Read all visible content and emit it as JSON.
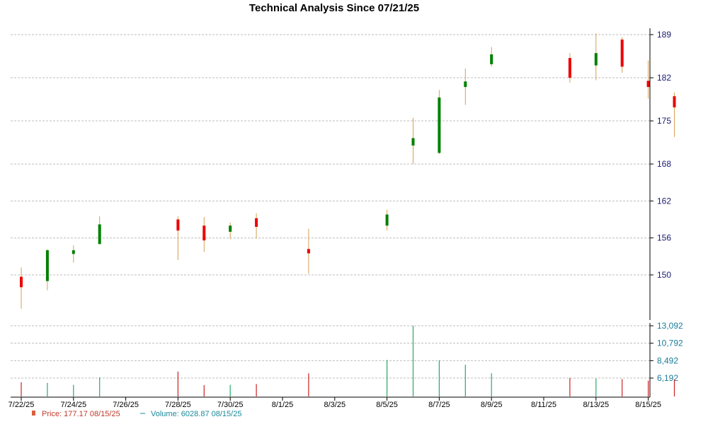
{
  "title": "Technical Analysis Since 07/21/25",
  "legend": {
    "price": "Price: 177.17  08/15/25",
    "volume": "Volume: 6028.87  08/15/25"
  },
  "colors": {
    "up": "#008000",
    "down": "#ee0000",
    "wick": "#d4a055",
    "grid": "#bdbdbd",
    "volume_up": "#2aa86a",
    "volume_down": "#cc2222",
    "price_axis": "#1a1a6e",
    "volume_axis": "#1a7a9a",
    "legend_price": "#c0392b",
    "legend_volume": "#1a8a9a"
  },
  "chart_data": [
    {
      "type": "candlestick",
      "title": "Technical Analysis Since 07/21/25",
      "ylim": [
        143.5,
        190.5
      ],
      "yticks": [
        150,
        156,
        162,
        168,
        175,
        182,
        189
      ],
      "grid": true,
      "x_tick_labels": [
        "7/22/25",
        "7/24/25",
        "7/26/25",
        "7/28/25",
        "7/30/25",
        "8/1/25",
        "8/3/25",
        "8/5/25",
        "8/7/25",
        "8/9/25",
        "8/11/25",
        "8/13/25",
        "8/15/25"
      ],
      "candles": [
        {
          "date": "7/22/25",
          "open": 149.7,
          "high": 151.2,
          "low": 144.5,
          "close": 148.0
        },
        {
          "date": "7/23/25",
          "open": 149.0,
          "high": 154.2,
          "low": 147.5,
          "close": 154.0
        },
        {
          "date": "7/24/25",
          "open": 153.4,
          "high": 154.8,
          "low": 152.0,
          "close": 154.0
        },
        {
          "date": "7/25/25",
          "open": 155.0,
          "high": 159.5,
          "low": 155.0,
          "close": 158.2
        },
        {
          "date": "7/28/25",
          "open": 159.0,
          "high": 159.5,
          "low": 152.4,
          "close": 157.2
        },
        {
          "date": "7/29/25",
          "open": 158.0,
          "high": 159.4,
          "low": 153.7,
          "close": 155.6
        },
        {
          "date": "7/30/25",
          "open": 157.0,
          "high": 158.5,
          "low": 155.8,
          "close": 158.0
        },
        {
          "date": "7/31/25",
          "open": 159.2,
          "high": 160.0,
          "low": 155.9,
          "close": 157.8
        },
        {
          "date": "8/1/25",
          "open": 154.2,
          "high": 157.5,
          "low": 150.2,
          "close": 153.5
        },
        {
          "date": "8/4/25",
          "open": 158.0,
          "high": 160.6,
          "low": 157.2,
          "close": 159.8
        },
        {
          "date": "8/5/25",
          "open": 171.0,
          "high": 175.5,
          "low": 168.0,
          "close": 172.2
        },
        {
          "date": "8/6/25",
          "open": 169.8,
          "high": 180.0,
          "low": 169.6,
          "close": 178.8
        },
        {
          "date": "8/7/25",
          "open": 180.5,
          "high": 183.5,
          "low": 177.6,
          "close": 181.4
        },
        {
          "date": "8/8/25",
          "open": 184.2,
          "high": 187.0,
          "low": 183.8,
          "close": 185.8
        },
        {
          "date": "8/11/25",
          "open": 185.2,
          "high": 186.0,
          "low": 181.2,
          "close": 182.0
        },
        {
          "date": "8/12/25",
          "open": 184.0,
          "high": 189.2,
          "low": 181.6,
          "close": 186.0
        },
        {
          "date": "8/13/25",
          "open": 188.2,
          "high": 188.6,
          "low": 182.8,
          "close": 183.8
        },
        {
          "date": "8/14/25",
          "open": 181.5,
          "high": 184.8,
          "low": 178.6,
          "close": 180.5
        },
        {
          "date": "8/15/25",
          "open": 179.0,
          "high": 179.6,
          "low": 172.4,
          "close": 177.2
        }
      ]
    },
    {
      "type": "bar",
      "title": "",
      "ylim": [
        5200,
        13300
      ],
      "yticks": [
        6192,
        8492,
        10792,
        13092
      ],
      "ytick_labels": [
        "6,192",
        "8,492",
        "10,792",
        "13,092"
      ],
      "grid": true,
      "categories": [
        "7/22/25",
        "7/23/25",
        "7/24/25",
        "7/25/25",
        "7/28/25",
        "7/29/25",
        "7/30/25",
        "7/31/25",
        "8/1/25",
        "8/4/25",
        "8/5/25",
        "8/6/25",
        "8/7/25",
        "8/8/25",
        "8/11/25",
        "8/12/25",
        "8/13/25",
        "8/14/25",
        "8/15/25"
      ],
      "values": [
        5650,
        5550,
        5300,
        6300,
        7050,
        5250,
        5300,
        5400,
        6820,
        8580,
        13092,
        8550,
        7950,
        6820,
        6220,
        6120,
        6050,
        5850,
        6028.87
      ],
      "direction": [
        "down",
        "up",
        "up",
        "up",
        "down",
        "down",
        "up",
        "down",
        "down",
        "up",
        "up",
        "up",
        "up",
        "up",
        "down",
        "up",
        "down",
        "down",
        "down"
      ]
    }
  ]
}
